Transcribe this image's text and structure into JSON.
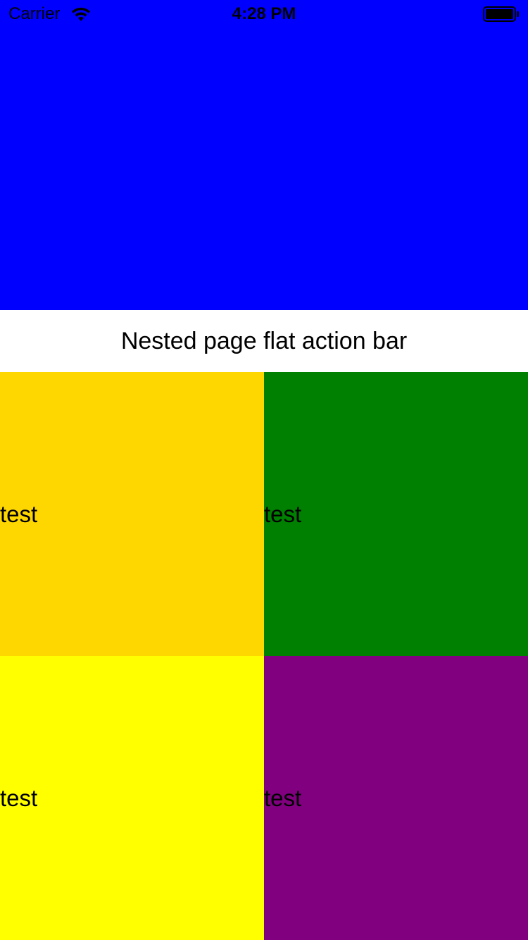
{
  "status_bar": {
    "carrier": "Carrier",
    "time": "4:28 PM",
    "wifi_icon": "wifi-icon",
    "battery_icon": "battery-full-icon"
  },
  "header": {
    "color": "#0000ff"
  },
  "action_bar": {
    "title": "Nested page flat action bar"
  },
  "tiles": [
    {
      "label": "test",
      "color": "#ffd700"
    },
    {
      "label": "test",
      "color": "#008000"
    },
    {
      "label": "test",
      "color": "#ffff00"
    },
    {
      "label": "test",
      "color": "#800080"
    }
  ]
}
